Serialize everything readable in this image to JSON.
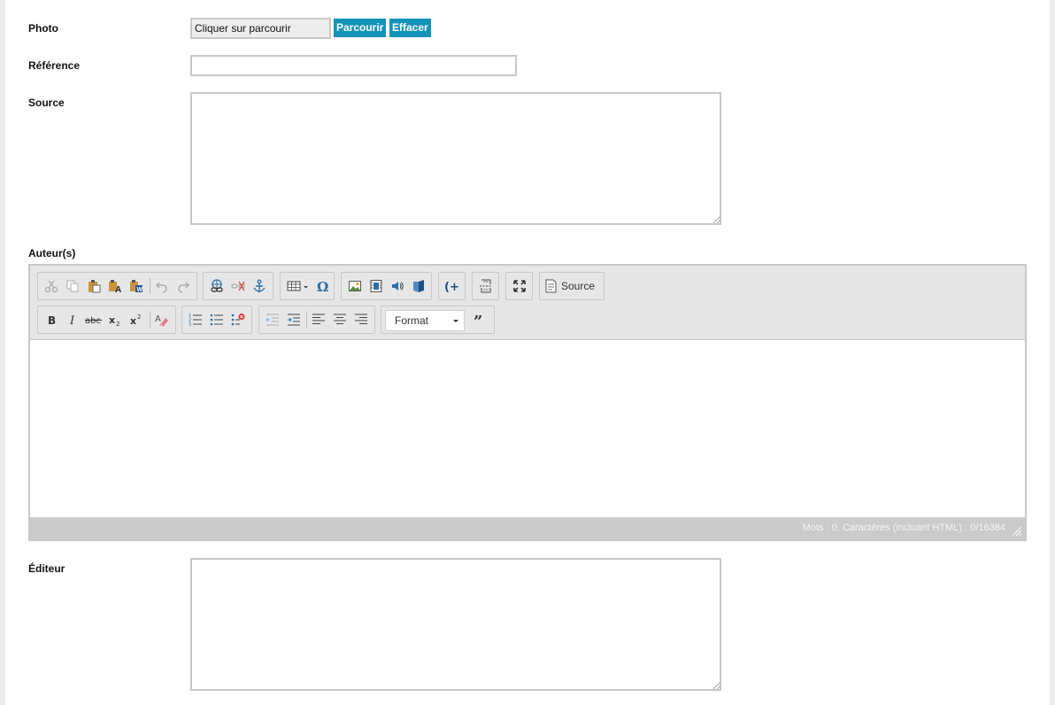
{
  "form": {
    "photo_label": "Photo",
    "photo_file_text": "Cliquer sur parcourir",
    "browse_button": "Parcourir",
    "clear_button": "Effacer",
    "reference_label": "Référence",
    "reference_value": "",
    "source_label": "Source",
    "source_value": "",
    "authors_label": "Auteur(s)",
    "editor_label": "Éditeur",
    "editor_value": ""
  },
  "rich_editor": {
    "source_button": "Source",
    "format_select": "Format",
    "counter_text": "Mots : 0, Caractères (incluant HTML) : 0/16384",
    "content": ""
  },
  "colors": {
    "accent": "#1393b7",
    "toolbar_bg": "#e6e6e6",
    "statusbar_bg": "#cbcbcb",
    "border": "#c8c8c8"
  },
  "icons": {
    "toolbar_row_1": [
      "cut-icon",
      "copy-icon",
      "paste-icon",
      "paste-text-icon",
      "paste-word-icon",
      "undo-icon",
      "redo-icon",
      "link-icon",
      "unlink-icon",
      "anchor-icon",
      "table-icon",
      "special-char-icon",
      "image-icon",
      "video-icon",
      "audio-icon",
      "flash-icon",
      "placeholder-icon",
      "page-break-icon",
      "maximize-icon",
      "source-icon"
    ],
    "toolbar_row_2": [
      "bold-icon",
      "italic-icon",
      "strikethrough-icon",
      "subscript-icon",
      "superscript-icon",
      "remove-format-icon",
      "numbered-list-icon",
      "bulleted-list-icon",
      "remove-list-icon",
      "outdent-icon",
      "indent-icon",
      "align-left-icon",
      "align-center-icon",
      "align-right-icon",
      "blockquote-icon"
    ]
  }
}
